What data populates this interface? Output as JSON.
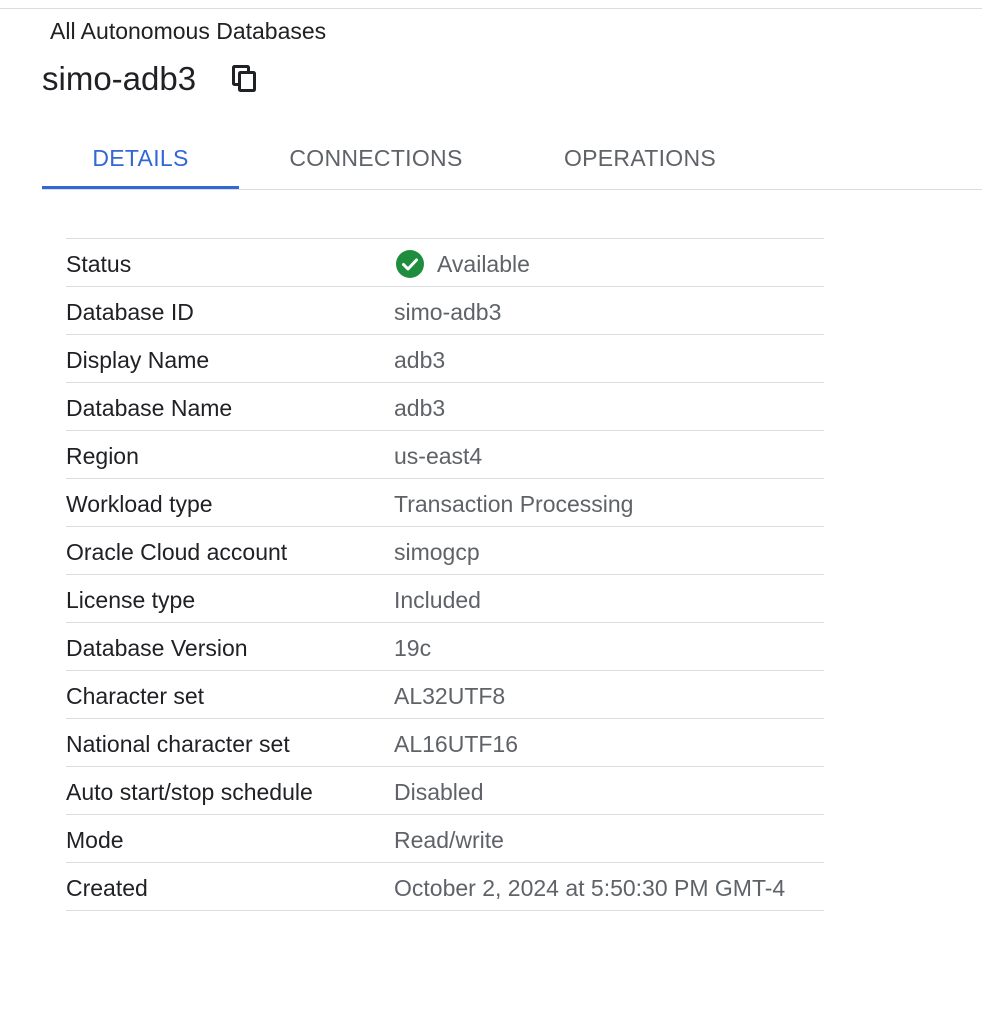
{
  "breadcrumb": "All Autonomous Databases",
  "page_title": "simo-adb3",
  "icons": {
    "copy": "copy-icon",
    "status": "check-circle-icon"
  },
  "colors": {
    "accent": "#3367d6",
    "status_ok": "#1e8e3e"
  },
  "tabs": [
    {
      "label": "DETAILS",
      "active": true
    },
    {
      "label": "CONNECTIONS",
      "active": false
    },
    {
      "label": "OPERATIONS",
      "active": false
    }
  ],
  "details": [
    {
      "label": "Status",
      "value": "Available"
    },
    {
      "label": "Database ID",
      "value": "simo-adb3"
    },
    {
      "label": "Display Name",
      "value": "adb3"
    },
    {
      "label": "Database Name",
      "value": "adb3"
    },
    {
      "label": "Region",
      "value": "us-east4"
    },
    {
      "label": "Workload type",
      "value": "Transaction Processing"
    },
    {
      "label": "Oracle Cloud account",
      "value": "simogcp"
    },
    {
      "label": "License type",
      "value": "Included"
    },
    {
      "label": "Database Version",
      "value": "19c"
    },
    {
      "label": "Character set",
      "value": "AL32UTF8"
    },
    {
      "label": "National character set",
      "value": "AL16UTF16"
    },
    {
      "label": "Auto start/stop schedule",
      "value": "Disabled"
    },
    {
      "label": "Mode",
      "value": "Read/write"
    },
    {
      "label": "Created",
      "value": "October 2, 2024 at 5:50:30 PM GMT-4"
    }
  ]
}
